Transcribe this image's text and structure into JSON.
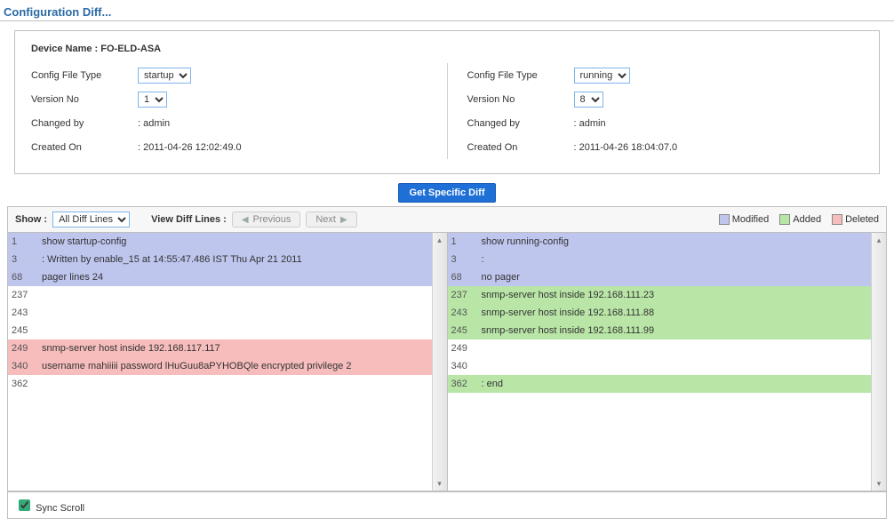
{
  "title": "Configuration  Diff...",
  "device": {
    "label": "Device Name :",
    "value": "FO-ELD-ASA"
  },
  "left": {
    "config_type_label": "Config File Type",
    "config_type_value": "startup",
    "version_label": "Version No",
    "version_value": "1",
    "changed_by_label": "Changed by",
    "changed_by_value": ": admin",
    "created_on_label": "Created On",
    "created_on_value": ": 2011-04-26 12:02:49.0"
  },
  "right": {
    "config_type_label": "Config File Type",
    "config_type_value": "running",
    "version_label": "Version No",
    "version_value": "8",
    "changed_by_label": "Changed by",
    "changed_by_value": ": admin",
    "created_on_label": "Created On",
    "created_on_value": ": 2011-04-26 18:04:07.0"
  },
  "buttons": {
    "get_diff": "Get Specific Diff",
    "show_label": "Show :",
    "show_value": "All Diff Lines",
    "view_label": "View Diff Lines :",
    "previous": "Previous",
    "next": "Next"
  },
  "legend": {
    "modified": "Modified",
    "added": "Added",
    "deleted": "Deleted"
  },
  "diff_left": [
    {
      "n": "1",
      "t": "show startup-config",
      "c": "mod"
    },
    {
      "n": "3",
      "t": ": Written by enable_15 at 14:55:47.486 IST Thu Apr 21 2011",
      "c": "mod"
    },
    {
      "n": "68",
      "t": "pager lines 24",
      "c": "mod"
    },
    {
      "n": "237",
      "t": "",
      "c": ""
    },
    {
      "n": "243",
      "t": "",
      "c": ""
    },
    {
      "n": "245",
      "t": "",
      "c": ""
    },
    {
      "n": "249",
      "t": "snmp-server host inside 192.168.117.117",
      "c": "del"
    },
    {
      "n": "340",
      "t": "username mahiiiii password lHuGuu8aPYHOBQle encrypted privilege 2",
      "c": "del"
    },
    {
      "n": "362",
      "t": "",
      "c": ""
    }
  ],
  "diff_right": [
    {
      "n": "1",
      "t": "show running-config",
      "c": "mod"
    },
    {
      "n": "3",
      "t": ":",
      "c": "mod"
    },
    {
      "n": "68",
      "t": "no pager",
      "c": "mod"
    },
    {
      "n": "237",
      "t": "snmp-server host inside 192.168.111.23",
      "c": "add"
    },
    {
      "n": "243",
      "t": "snmp-server host inside 192.168.111.88",
      "c": "add"
    },
    {
      "n": "245",
      "t": "snmp-server host inside 192.168.111.99",
      "c": "add"
    },
    {
      "n": "249",
      "t": "",
      "c": ""
    },
    {
      "n": "340",
      "t": "",
      "c": ""
    },
    {
      "n": "362",
      "t": ": end",
      "c": "add"
    }
  ],
  "footer": {
    "sync_scroll": "Sync Scroll"
  }
}
